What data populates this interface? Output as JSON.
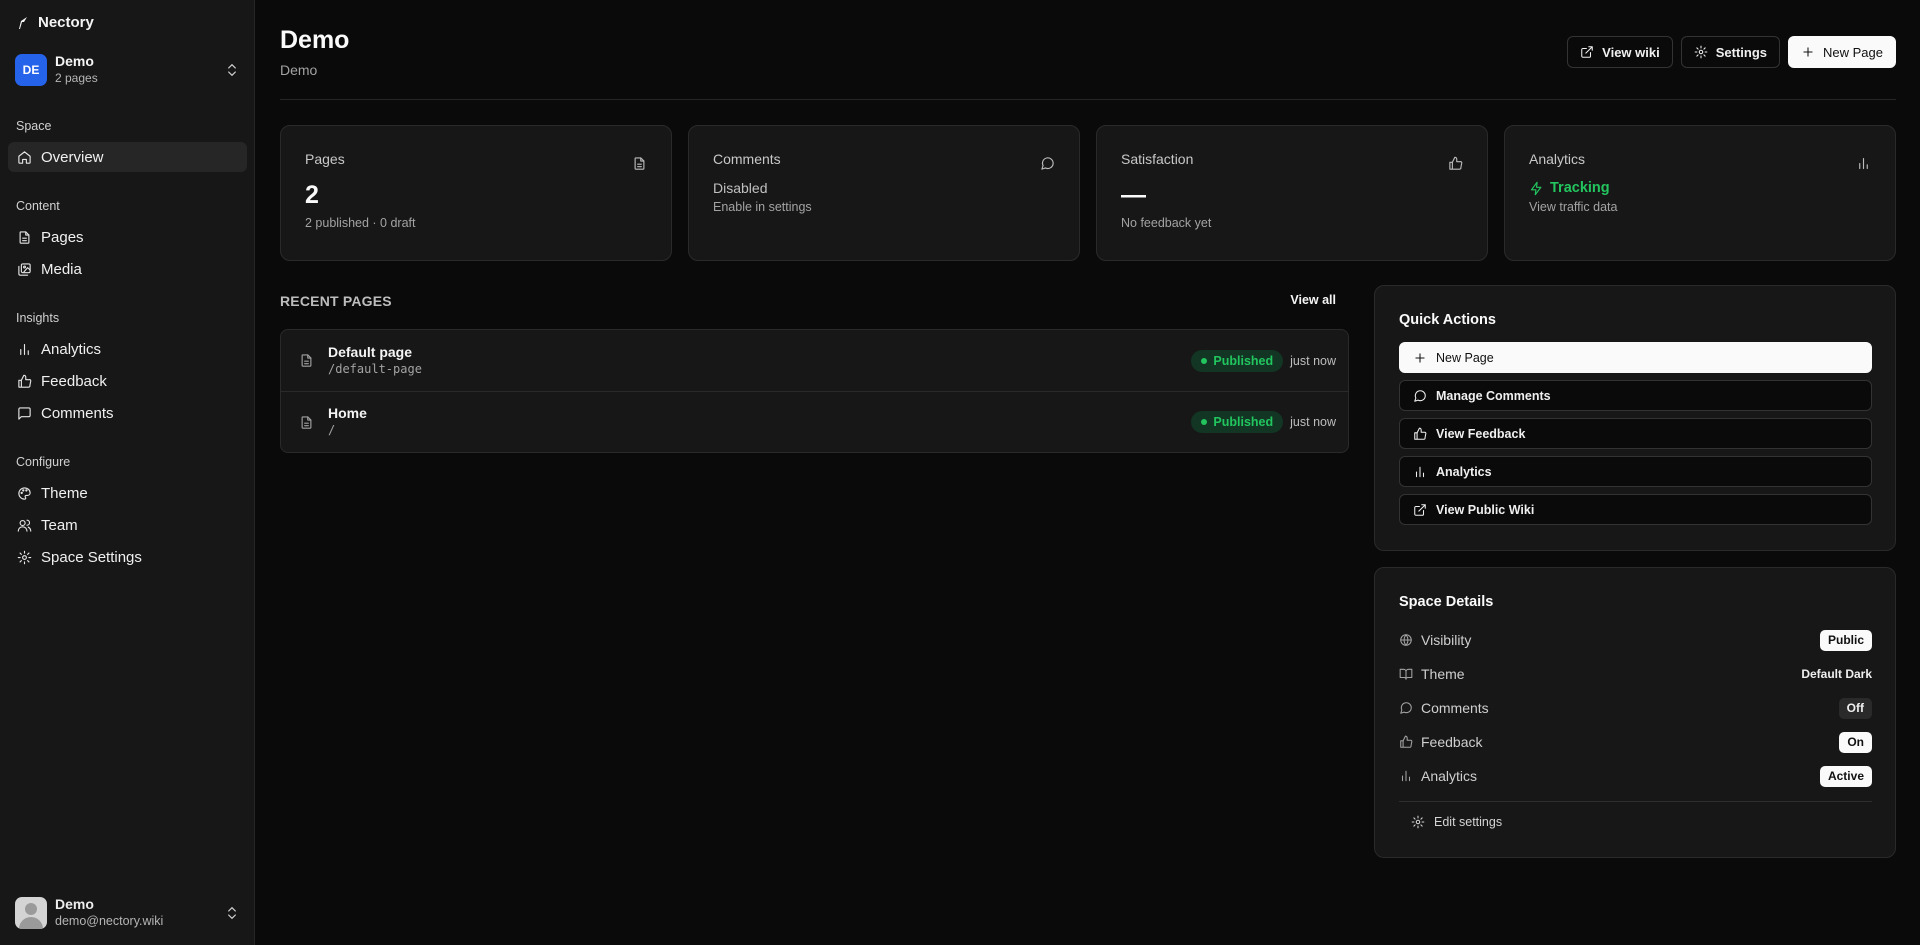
{
  "brand": {
    "name": "Nectory"
  },
  "space": {
    "initials": "DE",
    "name": "Demo",
    "page_count": "2 pages"
  },
  "sidebar": {
    "groups": [
      {
        "label": "Space",
        "items": [
          {
            "label": "Overview",
            "icon": "home-icon",
            "active": true
          }
        ]
      },
      {
        "label": "Content",
        "items": [
          {
            "label": "Pages",
            "icon": "file-icon"
          },
          {
            "label": "Media",
            "icon": "images-icon"
          }
        ]
      },
      {
        "label": "Insights",
        "items": [
          {
            "label": "Analytics",
            "icon": "bar-chart-icon"
          },
          {
            "label": "Feedback",
            "icon": "thumbs-up-icon"
          },
          {
            "label": "Comments",
            "icon": "message-square-icon"
          }
        ]
      },
      {
        "label": "Configure",
        "items": [
          {
            "label": "Theme",
            "icon": "palette-icon"
          },
          {
            "label": "Team",
            "icon": "users-icon"
          },
          {
            "label": "Space Settings",
            "icon": "gear-icon"
          }
        ]
      }
    ]
  },
  "user": {
    "name": "Demo",
    "email": "demo@nectory.wiki"
  },
  "header": {
    "title": "Demo",
    "subtitle": "Demo",
    "view_wiki": "View wiki",
    "settings": "Settings",
    "new_page": "New Page"
  },
  "stats": {
    "pages": {
      "label": "Pages",
      "value": "2",
      "note": "2 published · 0 draft"
    },
    "comments": {
      "label": "Comments",
      "status": "Disabled",
      "note": "Enable in settings"
    },
    "satisfaction": {
      "label": "Satisfaction",
      "value": "—",
      "note": "No feedback yet"
    },
    "analytics": {
      "label": "Analytics",
      "status": "Tracking",
      "note": "View traffic data"
    }
  },
  "recent": {
    "title": "RECENT PAGES",
    "view_all": "View all",
    "rows": [
      {
        "title": "Default page",
        "slug": "/default-page",
        "status": "Published",
        "time": "just now"
      },
      {
        "title": "Home",
        "slug": "/",
        "status": "Published",
        "time": "just now"
      }
    ]
  },
  "quick_actions": {
    "title": "Quick Actions",
    "new_page": "New Page",
    "manage_comments": "Manage Comments",
    "view_feedback": "View Feedback",
    "analytics": "Analytics",
    "view_public_wiki": "View Public Wiki"
  },
  "space_details": {
    "title": "Space Details",
    "visibility": {
      "label": "Visibility",
      "value": "Public"
    },
    "theme": {
      "label": "Theme",
      "value": "Default Dark"
    },
    "comments": {
      "label": "Comments",
      "value": "Off"
    },
    "feedback": {
      "label": "Feedback",
      "value": "On"
    },
    "analytics": {
      "label": "Analytics",
      "value": "Active"
    },
    "edit_settings": "Edit settings"
  },
  "colors": {
    "accent_green": "#22c55e",
    "avatar_blue": "#2563eb",
    "background": "#0a0a0a",
    "card": "#171717"
  }
}
